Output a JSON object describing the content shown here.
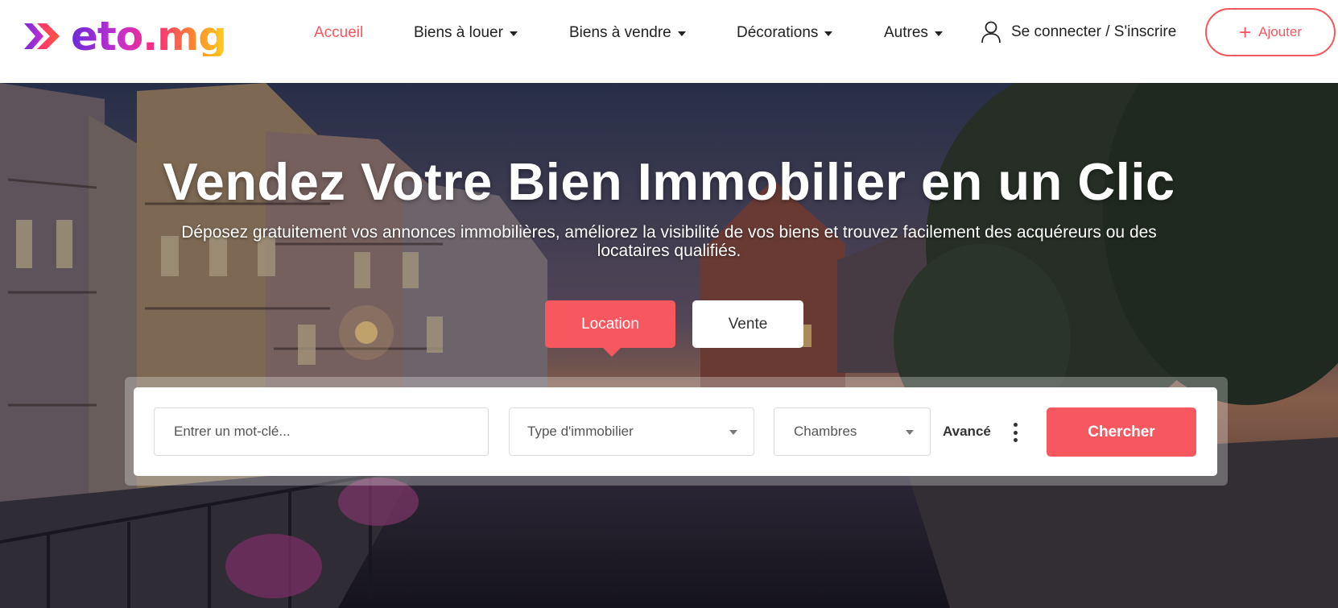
{
  "brand": {
    "logo_text": "eto.mg",
    "accent": "#f7585f"
  },
  "nav": {
    "items": [
      {
        "label": "Accueil",
        "active": true,
        "dropdown": false
      },
      {
        "label": "Biens à louer",
        "active": false,
        "dropdown": true
      },
      {
        "label": "Biens à vendre",
        "active": false,
        "dropdown": true
      },
      {
        "label": "Décorations",
        "active": false,
        "dropdown": true
      },
      {
        "label": "Autres",
        "active": false,
        "dropdown": true
      }
    ],
    "login_label": "Se connecter / S'inscrire",
    "add_label": "Ajouter",
    "login_icon": "user-icon",
    "add_icon": "plus-icon"
  },
  "hero": {
    "title": "Vendez Votre Bien Immobilier en un Clic",
    "subtitle": "Déposez gratuitement vos annonces immobilières, améliorez la visibilité de vos biens et trouvez facilement des acquéreurs ou des locataires qualifiés.",
    "tabs": [
      {
        "label": "Location",
        "active": true
      },
      {
        "label": "Vente",
        "active": false
      }
    ]
  },
  "search": {
    "keyword_placeholder": "Entrer un mot-clé...",
    "property_type": "Type d'immobilier",
    "rooms": "Chambres",
    "advanced_label": "Avancé",
    "more_icon": "kebab-icon",
    "submit_label": "Chercher"
  }
}
